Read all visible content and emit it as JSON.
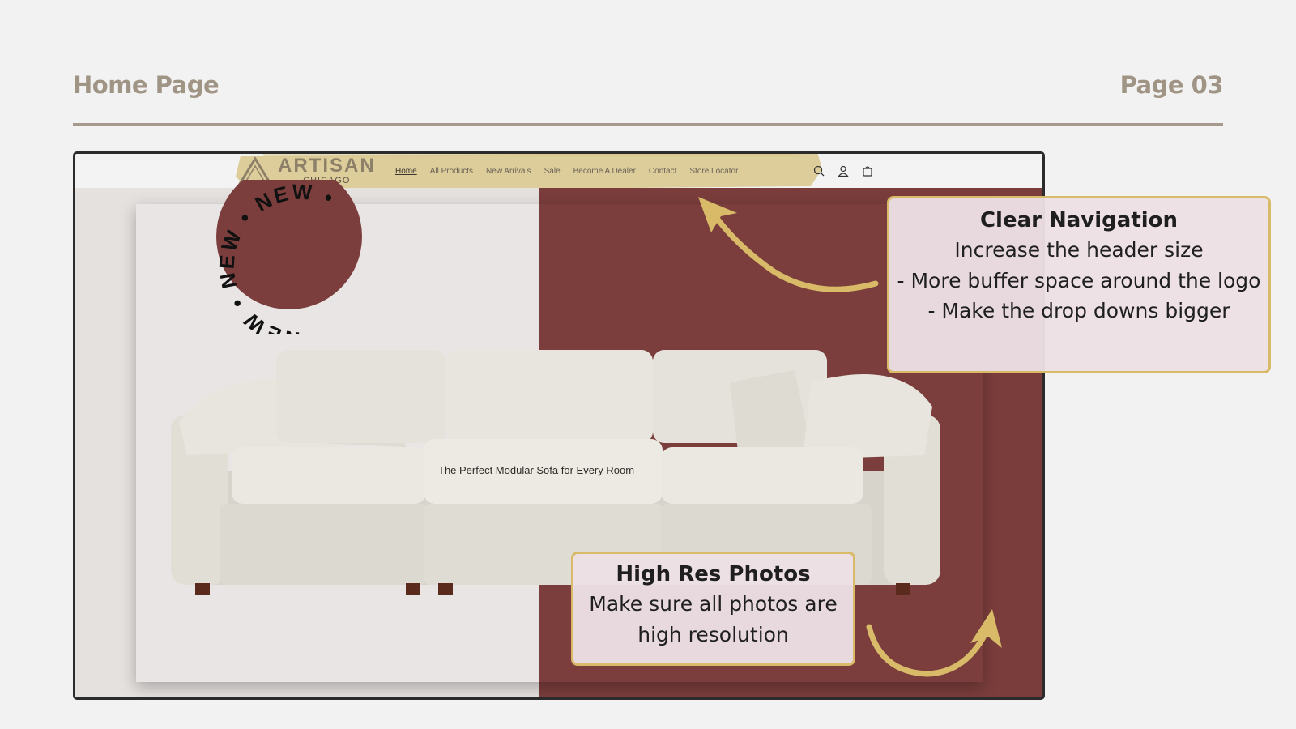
{
  "slide": {
    "title": "Home Page",
    "page_label": "Page 03"
  },
  "site": {
    "logo_name": "ARTISAN",
    "logo_sub": "CHICAGO",
    "nav": [
      {
        "label": "Home",
        "active": true
      },
      {
        "label": "All Products"
      },
      {
        "label": "New Arrivals"
      },
      {
        "label": "Sale"
      },
      {
        "label": "Become A Dealer"
      },
      {
        "label": "Contact"
      },
      {
        "label": "Store Locator"
      }
    ],
    "icons": [
      "search-icon",
      "account-icon",
      "cart-icon"
    ]
  },
  "hero": {
    "badge_text": "NEW • NEW • NEW •",
    "tagline": "The Perfect Modular Sofa for Every Room",
    "colors": {
      "maroon": "#7b3e3d",
      "light": "#e8e5e4"
    }
  },
  "callouts": {
    "navigation": {
      "title": "Clear Navigation",
      "lines": [
        "Increase the header size",
        "- More buffer space around the logo",
        "- Make the drop downs bigger"
      ]
    },
    "photos": {
      "title": "High Res Photos",
      "lines": [
        "Make sure all photos are high resolution"
      ]
    }
  },
  "accent_color": "#d8ba68"
}
